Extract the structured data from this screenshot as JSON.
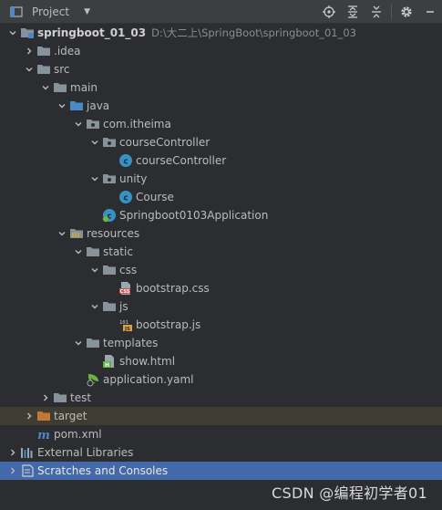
{
  "toolbar": {
    "title": "Project",
    "icons": [
      "project-window-icon",
      "chevron-down-icon",
      "locate-icon",
      "expand-all-icon",
      "collapse-all-icon",
      "gear-icon",
      "minimize-icon"
    ]
  },
  "tree": [
    {
      "name": "springboot_01_03",
      "path": "D:\\大二上\\SpringBoot\\springboot_01_03",
      "icon": "module-folder-icon",
      "expanded": true,
      "depth": 0,
      "bold": true
    },
    {
      "name": ".idea",
      "icon": "folder-icon",
      "expanded": false,
      "depth": 1
    },
    {
      "name": "src",
      "icon": "folder-icon",
      "expanded": true,
      "depth": 1
    },
    {
      "name": "main",
      "icon": "folder-icon",
      "expanded": true,
      "depth": 2
    },
    {
      "name": "java",
      "icon": "source-folder-icon",
      "expanded": true,
      "depth": 3
    },
    {
      "name": "com.itheima",
      "icon": "package-icon",
      "expanded": true,
      "depth": 4
    },
    {
      "name": "courseController",
      "icon": "package-icon",
      "expanded": true,
      "depth": 5
    },
    {
      "name": "courseController",
      "icon": "class-icon",
      "depth": 6
    },
    {
      "name": "unity",
      "icon": "package-icon",
      "expanded": true,
      "depth": 5
    },
    {
      "name": "Course",
      "icon": "class-icon",
      "depth": 6
    },
    {
      "name": "Springboot0103Application",
      "icon": "spring-boot-class-icon",
      "depth": 5
    },
    {
      "name": "resources",
      "icon": "resources-folder-icon",
      "expanded": true,
      "depth": 3
    },
    {
      "name": "static",
      "icon": "folder-icon",
      "expanded": true,
      "depth": 4
    },
    {
      "name": "css",
      "icon": "folder-icon",
      "expanded": true,
      "depth": 5
    },
    {
      "name": "bootstrap.css",
      "icon": "css-file-icon",
      "depth": 6
    },
    {
      "name": "js",
      "icon": "folder-icon",
      "expanded": true,
      "depth": 5
    },
    {
      "name": "bootstrap.js",
      "icon": "js-file-icon",
      "depth": 6
    },
    {
      "name": "templates",
      "icon": "folder-icon",
      "expanded": true,
      "depth": 4
    },
    {
      "name": "show.html",
      "icon": "html-file-icon",
      "depth": 5
    },
    {
      "name": "application.yaml",
      "icon": "yaml-spring-icon",
      "depth": 4
    },
    {
      "name": "test",
      "icon": "folder-icon",
      "expanded": false,
      "depth": 2
    },
    {
      "name": "target",
      "icon": "excluded-folder-icon",
      "expanded": false,
      "depth": 1,
      "highlight": "target"
    },
    {
      "name": "pom.xml",
      "icon": "maven-icon",
      "depth": 1
    },
    {
      "name": "External Libraries",
      "icon": "libraries-icon",
      "expanded": false,
      "depth": 0
    },
    {
      "name": "Scratches and Consoles",
      "icon": "scratches-icon",
      "expanded": false,
      "depth": 0,
      "highlight": "selected"
    }
  ],
  "watermark": "CSDN @编程初学者01",
  "colors": {
    "background": "#2b2d30",
    "toolbar": "#3c3f41",
    "selection": "#4369a8",
    "target_row": "#3f3c33",
    "folder": "#87939a",
    "source_folder": "#4a88c7",
    "class_icon": "#3592c4"
  }
}
